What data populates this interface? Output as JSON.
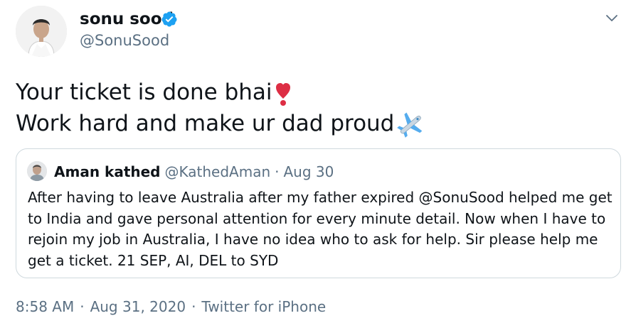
{
  "author": {
    "display_name": "sonu sood",
    "handle": "@SonuSood",
    "verified": true
  },
  "tweet": {
    "lines": [
      "Your ticket is done bhai",
      "Work hard and make ur dad proud"
    ],
    "emojis": [
      "heavy-exclamation-mark-icon",
      "airplane-icon"
    ]
  },
  "quoted_tweet": {
    "display_name": "Aman kathed",
    "handle": "@KathedAman",
    "separator": "·",
    "date": "Aug 30",
    "lines": [
      "After having to leave Australia after my father expired @SonuSood helped me get",
      "to India and gave personal attention for every minute detail. Now when I have to",
      "rejoin my job in Australia, I have no idea who to ask for help. Sir please help me",
      "get a ticket. 21 SEP, AI, DEL to SYD"
    ]
  },
  "footer": {
    "time": "8:58 AM",
    "date": "Aug 31, 2020",
    "source": "Twitter for iPhone",
    "separator": "·"
  },
  "colors": {
    "text": "#0f1419",
    "secondary": "#5b7083",
    "verified_blue": "#1da1f2",
    "border": "#cfd9de",
    "heart_red": "#dd2e44"
  }
}
